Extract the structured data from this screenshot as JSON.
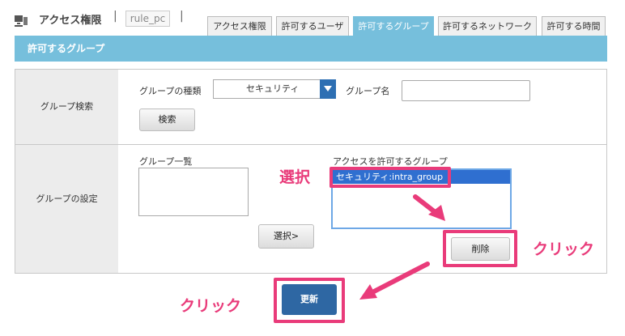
{
  "header": {
    "title": "アクセス権限",
    "sep1": "|",
    "rule_name": "rule_pc",
    "sep2": "|"
  },
  "tabs": [
    {
      "label": "アクセス権限",
      "active": false
    },
    {
      "label": "許可するユーザ",
      "active": false
    },
    {
      "label": "許可するグループ",
      "active": true
    },
    {
      "label": "許可するネットワーク",
      "active": false
    },
    {
      "label": "許可する時間",
      "active": false
    }
  ],
  "section_title": "許可するグループ",
  "search": {
    "row_label": "グループ検索",
    "type_label": "グループの種類",
    "type_value": "セキュリティ",
    "name_label": "グループ名",
    "name_value": "",
    "button": "検索"
  },
  "settings": {
    "row_label": "グループの設定",
    "list_label": "グループ一覧",
    "allowed_label": "アクセスを許可するグループ",
    "allowed_items": [
      "セキュリティ:intra_group"
    ],
    "select_button": "選択>",
    "delete_button": "削除"
  },
  "update_button": "更新",
  "annotations": {
    "select": "選択",
    "click1": "クリック",
    "click2": "クリック",
    "color": "#e93b7a"
  },
  "colors": {
    "tab_active": "#76bfdc",
    "primary": "#2e67a3",
    "selected": "#2f6fd0"
  }
}
